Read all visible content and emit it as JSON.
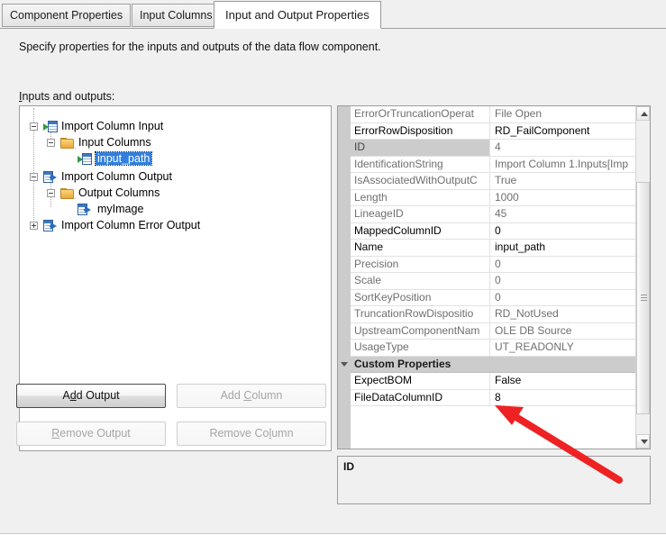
{
  "tabs": [
    {
      "label": "Component Properties",
      "active": false
    },
    {
      "label": "Input Columns",
      "active": false
    },
    {
      "label": "Input and Output Properties",
      "active": true
    }
  ],
  "page": {
    "description": "Specify properties for the inputs and outputs of the data flow component.",
    "io_label_accel": "I",
    "io_label_rest": "nputs and outputs:"
  },
  "tree": {
    "nodes": [
      {
        "label": "Import Column Input",
        "icon": "input-icon",
        "depth": 0,
        "expander": "minus",
        "selected": false
      },
      {
        "label": "Input Columns",
        "icon": "folder-icon",
        "depth": 1,
        "expander": "minus",
        "selected": false
      },
      {
        "label": "input_path",
        "icon": "input-icon",
        "depth": 2,
        "expander": "none",
        "selected": true
      },
      {
        "label": "Import Column Output",
        "icon": "output-icon",
        "depth": 0,
        "expander": "minus",
        "selected": false
      },
      {
        "label": "Output Columns",
        "icon": "folder-icon",
        "depth": 1,
        "expander": "minus",
        "selected": false
      },
      {
        "label": "myImage",
        "icon": "output-icon",
        "depth": 2,
        "expander": "none",
        "selected": false
      },
      {
        "label": "Import Column Error Output",
        "icon": "output-icon",
        "depth": 0,
        "expander": "plus",
        "selected": false
      }
    ]
  },
  "buttons": {
    "add_output": {
      "pre": "A",
      "accel": "d",
      "post": "d Output",
      "enabled": true,
      "default": true
    },
    "add_column": {
      "pre": "Add ",
      "accel": "C",
      "post": "olumn",
      "enabled": false,
      "default": false
    },
    "remove_output": {
      "pre": "",
      "accel": "R",
      "post": "emove Output",
      "enabled": false,
      "default": false
    },
    "remove_column": {
      "pre": "Remove Co",
      "accel": "l",
      "post": "umn",
      "enabled": false,
      "default": false
    }
  },
  "grid": {
    "rows": [
      {
        "name": "ErrorOrTruncationOperat",
        "value": "File Open",
        "editable": false,
        "selected": false
      },
      {
        "name": "ErrorRowDisposition",
        "value": "RD_FailComponent",
        "editable": true,
        "selected": false
      },
      {
        "name": "ID",
        "value": "4",
        "editable": false,
        "selected": true
      },
      {
        "name": "IdentificationString",
        "value": "Import Column 1.Inputs[Imp",
        "editable": false,
        "selected": false
      },
      {
        "name": "IsAssociatedWithOutputC",
        "value": "True",
        "editable": false,
        "selected": false
      },
      {
        "name": "Length",
        "value": "1000",
        "editable": false,
        "selected": false
      },
      {
        "name": "LineageID",
        "value": "45",
        "editable": false,
        "selected": false
      },
      {
        "name": "MappedColumnID",
        "value": "0",
        "editable": true,
        "selected": false
      },
      {
        "name": "Name",
        "value": "input_path",
        "editable": true,
        "selected": false
      },
      {
        "name": "Precision",
        "value": "0",
        "editable": false,
        "selected": false
      },
      {
        "name": "Scale",
        "value": "0",
        "editable": false,
        "selected": false
      },
      {
        "name": "SortKeyPosition",
        "value": "0",
        "editable": false,
        "selected": false
      },
      {
        "name": "TruncationRowDispositio",
        "value": "RD_NotUsed",
        "editable": false,
        "selected": false
      },
      {
        "name": "UpstreamComponentNam",
        "value": "OLE DB Source",
        "editable": false,
        "selected": false
      },
      {
        "name": "UsageType",
        "value": "UT_READONLY",
        "editable": false,
        "selected": false
      }
    ],
    "category": {
      "label": "Custom Properties"
    },
    "custom_rows": [
      {
        "name": "ExpectBOM",
        "value": "False",
        "editable": true,
        "selected": false
      },
      {
        "name": "FileDataColumnID",
        "value": "8",
        "editable": true,
        "selected": false
      }
    ]
  },
  "description_pane": {
    "title": "ID"
  },
  "annotation": {
    "color": "#ee2222",
    "shape": "arrow"
  }
}
